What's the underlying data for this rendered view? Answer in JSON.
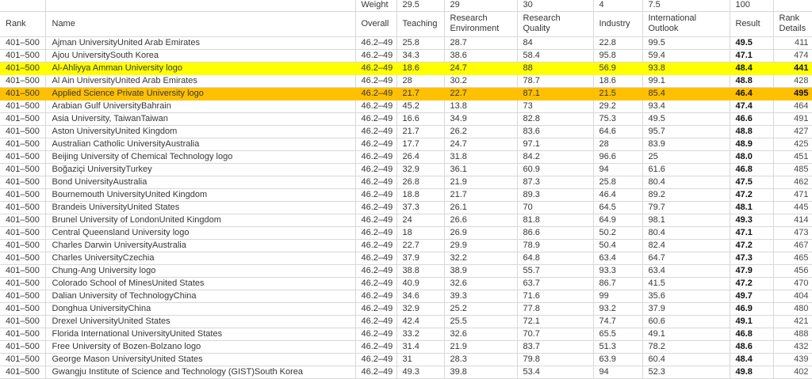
{
  "sheet": {
    "weight_row": {
      "label": "Weight",
      "teaching": "29.5",
      "research_environment": "29",
      "research_quality": "30",
      "industry": "4",
      "international_outlook": "7.5",
      "result": "100"
    },
    "columns": [
      {
        "key": "rank",
        "label": "Rank"
      },
      {
        "key": "name",
        "label": "Name"
      },
      {
        "key": "overall",
        "label": "Overall"
      },
      {
        "key": "teaching",
        "label": "Teaching"
      },
      {
        "key": "research_environment",
        "label": "Research Environment"
      },
      {
        "key": "research_quality",
        "label": "Research Quality"
      },
      {
        "key": "industry",
        "label": "Industry"
      },
      {
        "key": "international_outlook",
        "label": "International Outlook"
      },
      {
        "key": "result",
        "label": "Result"
      },
      {
        "key": "rank_details",
        "label": "Rank Details"
      }
    ],
    "colors": {
      "yellow": "#FFFF00",
      "orange": "#FFC000",
      "gridline": "#D8D8D8"
    },
    "rows": [
      {
        "rank": "401–500",
        "name": "Ajman UniversityUnited Arab Emirates",
        "overall": "46.2–49",
        "teaching": "25.8",
        "research_environment": "28.7",
        "research_quality": "84",
        "industry": "22.8",
        "international_outlook": "99.5",
        "result": "49.5",
        "rank_details": "411",
        "highlight": null
      },
      {
        "rank": "401–500",
        "name": "Ajou UniversitySouth Korea",
        "overall": "46.2–49",
        "teaching": "34.3",
        "research_environment": "38.6",
        "research_quality": "58.4",
        "industry": "95.8",
        "international_outlook": "59.4",
        "result": "47.1",
        "rank_details": "474",
        "highlight": null
      },
      {
        "rank": "401–500",
        "name": "Al-Ahliyya Amman University logo",
        "overall": "46.2–49",
        "teaching": "18.6",
        "research_environment": "24.7",
        "research_quality": "88",
        "industry": "56.9",
        "international_outlook": "93.8",
        "result": "48.4",
        "rank_details": "441",
        "highlight": "yellow"
      },
      {
        "rank": "401–500",
        "name": "Al Ain UniversityUnited Arab Emirates",
        "overall": "46.2–49",
        "teaching": "28",
        "research_environment": "30.2",
        "research_quality": "78.7",
        "industry": "18.6",
        "international_outlook": "99.1",
        "result": "48.8",
        "rank_details": "428",
        "highlight": null
      },
      {
        "rank": "401–500",
        "name": "Applied Science Private University logo",
        "overall": "46.2–49",
        "teaching": "21.7",
        "research_environment": "22.7",
        "research_quality": "87.1",
        "industry": "21.5",
        "international_outlook": "85.4",
        "result": "46.4",
        "rank_details": "495",
        "highlight": "orange"
      },
      {
        "rank": "401–500",
        "name": "Arabian Gulf UniversityBahrain",
        "overall": "46.2–49",
        "teaching": "45.2",
        "research_environment": "13.8",
        "research_quality": "73",
        "industry": "29.2",
        "international_outlook": "93.4",
        "result": "47.4",
        "rank_details": "464",
        "highlight": null
      },
      {
        "rank": "401–500",
        "name": "Asia University, TaiwanTaiwan",
        "overall": "46.2–49",
        "teaching": "16.6",
        "research_environment": "34.9",
        "research_quality": "82.8",
        "industry": "75.3",
        "international_outlook": "49.5",
        "result": "46.6",
        "rank_details": "491",
        "highlight": null
      },
      {
        "rank": "401–500",
        "name": "Aston UniversityUnited Kingdom",
        "overall": "46.2–49",
        "teaching": "21.7",
        "research_environment": "26.2",
        "research_quality": "83.6",
        "industry": "64.6",
        "international_outlook": "95.7",
        "result": "48.8",
        "rank_details": "427",
        "highlight": null
      },
      {
        "rank": "401–500",
        "name": "Australian Catholic UniversityAustralia",
        "overall": "46.2–49",
        "teaching": "17.7",
        "research_environment": "24.7",
        "research_quality": "97.1",
        "industry": "28",
        "international_outlook": "83.9",
        "result": "48.9",
        "rank_details": "425",
        "highlight": null
      },
      {
        "rank": "401–500",
        "name": "Beijing University of Chemical Technology logo",
        "overall": "46.2–49",
        "teaching": "26.4",
        "research_environment": "31.8",
        "research_quality": "84.2",
        "industry": "96.6",
        "international_outlook": "25",
        "result": "48.0",
        "rank_details": "451",
        "highlight": null
      },
      {
        "rank": "401–500",
        "name": "Boğaziçi UniversityTurkey",
        "overall": "46.2–49",
        "teaching": "32.9",
        "research_environment": "36.1",
        "research_quality": "60.9",
        "industry": "94",
        "international_outlook": "61.6",
        "result": "46.8",
        "rank_details": "485",
        "highlight": null
      },
      {
        "rank": "401–500",
        "name": "Bond UniversityAustralia",
        "overall": "46.2–49",
        "teaching": "26.8",
        "research_environment": "21.9",
        "research_quality": "87.3",
        "industry": "25.8",
        "international_outlook": "80.4",
        "result": "47.5",
        "rank_details": "462",
        "highlight": null
      },
      {
        "rank": "401–500",
        "name": "Bournemouth UniversityUnited Kingdom",
        "overall": "46.2–49",
        "teaching": "18.8",
        "research_environment": "21.7",
        "research_quality": "89.3",
        "industry": "46.4",
        "international_outlook": "89.2",
        "result": "47.2",
        "rank_details": "471",
        "highlight": null
      },
      {
        "rank": "401–500",
        "name": "Brandeis UniversityUnited States",
        "overall": "46.2–49",
        "teaching": "37.3",
        "research_environment": "26.1",
        "research_quality": "70",
        "industry": "64.5",
        "international_outlook": "79.7",
        "result": "48.1",
        "rank_details": "445",
        "highlight": null
      },
      {
        "rank": "401–500",
        "name": "Brunel University of LondonUnited Kingdom",
        "overall": "46.2–49",
        "teaching": "24",
        "research_environment": "26.6",
        "research_quality": "81.8",
        "industry": "64.9",
        "international_outlook": "98.1",
        "result": "49.3",
        "rank_details": "414",
        "highlight": null
      },
      {
        "rank": "401–500",
        "name": "Central Queensland University logo",
        "overall": "46.2–49",
        "teaching": "18",
        "research_environment": "26.9",
        "research_quality": "86.6",
        "industry": "50.2",
        "international_outlook": "80.4",
        "result": "47.1",
        "rank_details": "473",
        "highlight": null
      },
      {
        "rank": "401–500",
        "name": "Charles Darwin UniversityAustralia",
        "overall": "46.2–49",
        "teaching": "22.7",
        "research_environment": "29.9",
        "research_quality": "78.9",
        "industry": "50.4",
        "international_outlook": "82.4",
        "result": "47.2",
        "rank_details": "467",
        "highlight": null
      },
      {
        "rank": "401–500",
        "name": "Charles UniversityCzechia",
        "overall": "46.2–49",
        "teaching": "37.9",
        "research_environment": "32.2",
        "research_quality": "64.8",
        "industry": "63.4",
        "international_outlook": "64.7",
        "result": "47.3",
        "rank_details": "465",
        "highlight": null
      },
      {
        "rank": "401–500",
        "name": "Chung-Ang University logo",
        "overall": "46.2–49",
        "teaching": "38.8",
        "research_environment": "38.9",
        "research_quality": "55.7",
        "industry": "93.3",
        "international_outlook": "63.4",
        "result": "47.9",
        "rank_details": "456",
        "highlight": null
      },
      {
        "rank": "401–500",
        "name": "Colorado School of MinesUnited States",
        "overall": "46.2–49",
        "teaching": "40.9",
        "research_environment": "32.6",
        "research_quality": "63.7",
        "industry": "86.7",
        "international_outlook": "41.5",
        "result": "47.2",
        "rank_details": "470",
        "highlight": null
      },
      {
        "rank": "401–500",
        "name": "Dalian University of TechnologyChina",
        "overall": "46.2–49",
        "teaching": "34.6",
        "research_environment": "39.3",
        "research_quality": "71.6",
        "industry": "99",
        "international_outlook": "35.6",
        "result": "49.7",
        "rank_details": "404",
        "highlight": null
      },
      {
        "rank": "401–500",
        "name": "Donghua UniversityChina",
        "overall": "46.2–49",
        "teaching": "32.9",
        "research_environment": "25.2",
        "research_quality": "77.8",
        "industry": "93.2",
        "international_outlook": "37.9",
        "result": "46.9",
        "rank_details": "480",
        "highlight": null
      },
      {
        "rank": "401–500",
        "name": "Drexel UniversityUnited States",
        "overall": "46.2–49",
        "teaching": "42.4",
        "research_environment": "25.5",
        "research_quality": "72.1",
        "industry": "74.7",
        "international_outlook": "60.6",
        "result": "49.1",
        "rank_details": "421",
        "highlight": null
      },
      {
        "rank": "401–500",
        "name": "Florida International UniversityUnited States",
        "overall": "46.2–49",
        "teaching": "33.2",
        "research_environment": "32.6",
        "research_quality": "70.7",
        "industry": "65.5",
        "international_outlook": "49.1",
        "result": "46.8",
        "rank_details": "488",
        "highlight": null
      },
      {
        "rank": "401–500",
        "name": "Free University of Bozen-Bolzano logo",
        "overall": "46.2–49",
        "teaching": "31.4",
        "research_environment": "21.9",
        "research_quality": "83.7",
        "industry": "51.3",
        "international_outlook": "78.2",
        "result": "48.6",
        "rank_details": "432",
        "highlight": null
      },
      {
        "rank": "401–500",
        "name": "George Mason UniversityUnited States",
        "overall": "46.2–49",
        "teaching": "31",
        "research_environment": "28.3",
        "research_quality": "79.8",
        "industry": "63.9",
        "international_outlook": "60.4",
        "result": "48.4",
        "rank_details": "439",
        "highlight": null
      },
      {
        "rank": "401–500",
        "name": "Gwangju Institute of Science and Technology (GIST)South Korea",
        "overall": "46.2–49",
        "teaching": "49.3",
        "research_environment": "39.8",
        "research_quality": "53.4",
        "industry": "94",
        "international_outlook": "52.3",
        "result": "49.8",
        "rank_details": "402",
        "highlight": null
      }
    ]
  }
}
